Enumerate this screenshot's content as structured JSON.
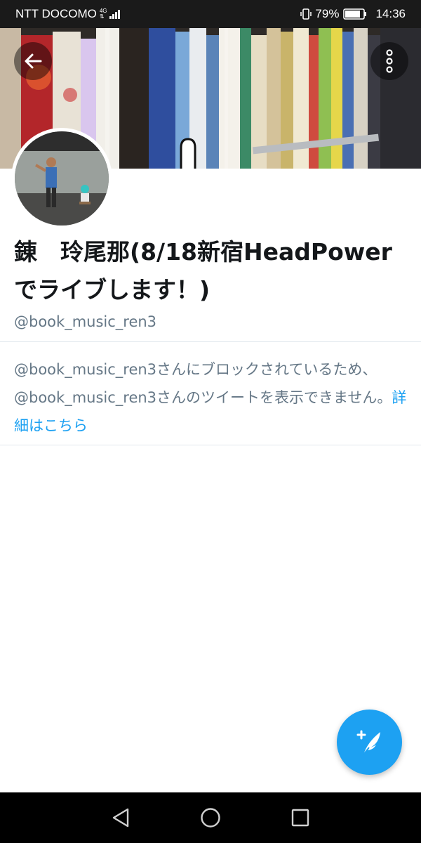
{
  "status_bar": {
    "carrier": "NTT DOCOMO",
    "network_top": "4G",
    "network_bottom": "⇅",
    "battery_percent": "79%",
    "time": "14:36",
    "icons": [
      "signal-icon",
      "vibrate-icon",
      "battery-icon"
    ]
  },
  "header": {
    "banner_image": "bookshelf-photo",
    "back_icon": "arrow-left-icon",
    "more_icon": "more-vertical-icon"
  },
  "profile": {
    "display_name": "錬　玲尾那(8/18新宿HeadPowerでライブします！)",
    "handle": "@book_music_ren3",
    "avatar_image": "performer-on-stage-photo"
  },
  "blocked_notice": {
    "message": "@book_music_ren3さんにブロックされているため、@book_music_ren3さんのツイートを表示できません。",
    "learn_more": "詳細はこちら"
  },
  "compose": {
    "icon": "compose-tweet-icon"
  },
  "nav": {
    "icons": [
      "back-triangle-icon",
      "home-circle-icon",
      "recents-square-icon"
    ]
  },
  "colors": {
    "accent": "#1da1f2",
    "text_primary": "#14171a",
    "text_secondary": "#657786",
    "divider": "#e1e8ed",
    "status_bar": "#1a1a1a",
    "nav_bar": "#000000"
  }
}
